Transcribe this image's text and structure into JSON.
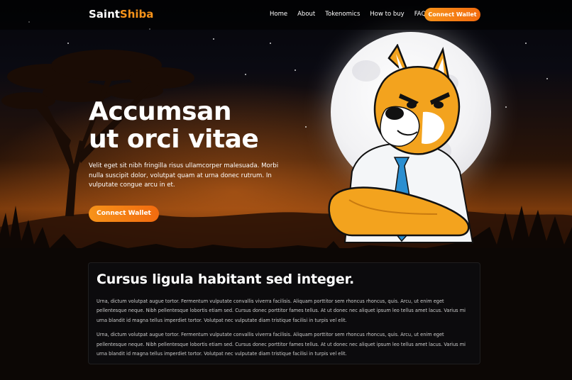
{
  "header": {
    "logo_part1": "Saint",
    "logo_part2": "Shiba",
    "nav": [
      "Home",
      "About",
      "Tokenomics",
      "How to buy",
      "FAQ"
    ],
    "connect_wallet": "Connect Wallet"
  },
  "hero": {
    "title_line1": "Accumsan",
    "title_line2": "ut orci vitae",
    "description": "Velit eget sit nibh fringilla risus ullamcorper malesuada. Morbi nulla suscipit dolor, volutpat quam at urna donec rutrum. In vulputate congue arcu in et.",
    "button": "Connect Wallet"
  },
  "card": {
    "heading": "Cursus ligula habitant sed integer.",
    "paragraph1": "Urna, dictum volutpat augue tortor. Fermentum vulputate convallis viverra facilisis. Aliquam porttitor sem rhoncus rhoncus, quis. Arcu, ut enim eget pellentesque neque. Nibh pellentesque lobortis etiam sed. Cursus donec porttitor fames tellus. At ut donec nec aliquet ipsum leo tellus amet lacus. Varius mi urna blandit id magna tellus imperdiet tortor. Volutpat nec vulputate diam tristique facilisi in turpis vel elit.",
    "paragraph2": "Urna, dictum volutpat augue tortor. Fermentum vulputate convallis viverra facilisis. Aliquam porttitor sem rhoncus rhoncus, quis. Arcu, ut enim eget pellentesque neque. Nibh pellentesque lobortis etiam sed. Cursus donec porttitor fames tellus. At ut donec nec aliquet ipsum leo tellus amet lacus. Varius mi urna blandit id magna tellus imperdiet tortor. Volutpat nec vulputate diam tristique facilisi in turpis vel elit."
  },
  "colors": {
    "accent": "#f7931a",
    "accent_dark": "#f26b0f",
    "sky": "#7a3a0c"
  },
  "icons": [
    "shiba-mascot-illustration",
    "moon-illustration",
    "acacia-tree-silhouette"
  ]
}
